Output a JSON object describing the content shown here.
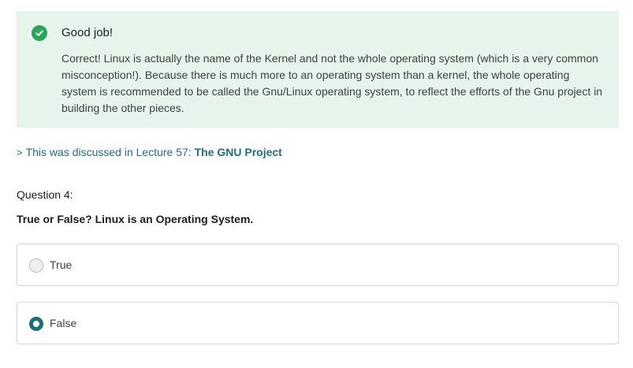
{
  "feedback": {
    "icon": "check-circle-icon",
    "title": "Good job!",
    "body": "Correct! Linux is actually the name of the Kernel and not the whole operating system (which is a very common misconception!). Because there is much more to an operating system than a kernel, the whole operating system is recommended to be called the Gnu/Linux operating system, to reflect the efforts of the Gnu project in building the other pieces.",
    "accent_color": "#2aa55b",
    "background_color": "#e6f4ec"
  },
  "lecture_reference": {
    "chevron_icon": "chevron-right-icon",
    "prefix": "This was discussed in Lecture 57: ",
    "link_text": "The GNU Project",
    "color": "#1f6f7a"
  },
  "question": {
    "number_label": "Question 4:",
    "text": "True or False? Linux is an Operating System.",
    "options": [
      {
        "label": "True",
        "selected": false
      },
      {
        "label": "False",
        "selected": true
      }
    ]
  }
}
